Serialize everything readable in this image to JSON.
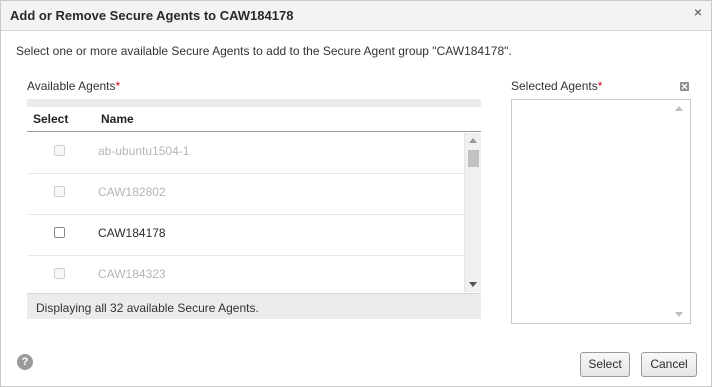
{
  "dialog": {
    "title": "Add or Remove Secure Agents to CAW184178",
    "close_glyph": "×",
    "instruction": "Select one or more available Secure Agents to add to the Secure Agent group \"CAW184178\"."
  },
  "available": {
    "label": "Available Agents",
    "required_mark": "*",
    "columns": {
      "select": "Select",
      "name": "Name"
    },
    "rows": [
      {
        "name": "ab-ubuntu1504-1",
        "enabled": false
      },
      {
        "name": "CAW182802",
        "enabled": false
      },
      {
        "name": "CAW184178",
        "enabled": true
      },
      {
        "name": "CAW184323",
        "enabled": false
      }
    ],
    "footer": "Displaying all 32 available Secure Agents."
  },
  "selected": {
    "label": "Selected Agents",
    "required_mark": "*"
  },
  "actions": {
    "help_glyph": "?",
    "select_label": "Select",
    "cancel_label": "Cancel"
  },
  "colors": {
    "required": "#d0021b",
    "disabled_text": "#b5b5b5",
    "titlebar_bg": "#f3f3f3"
  }
}
